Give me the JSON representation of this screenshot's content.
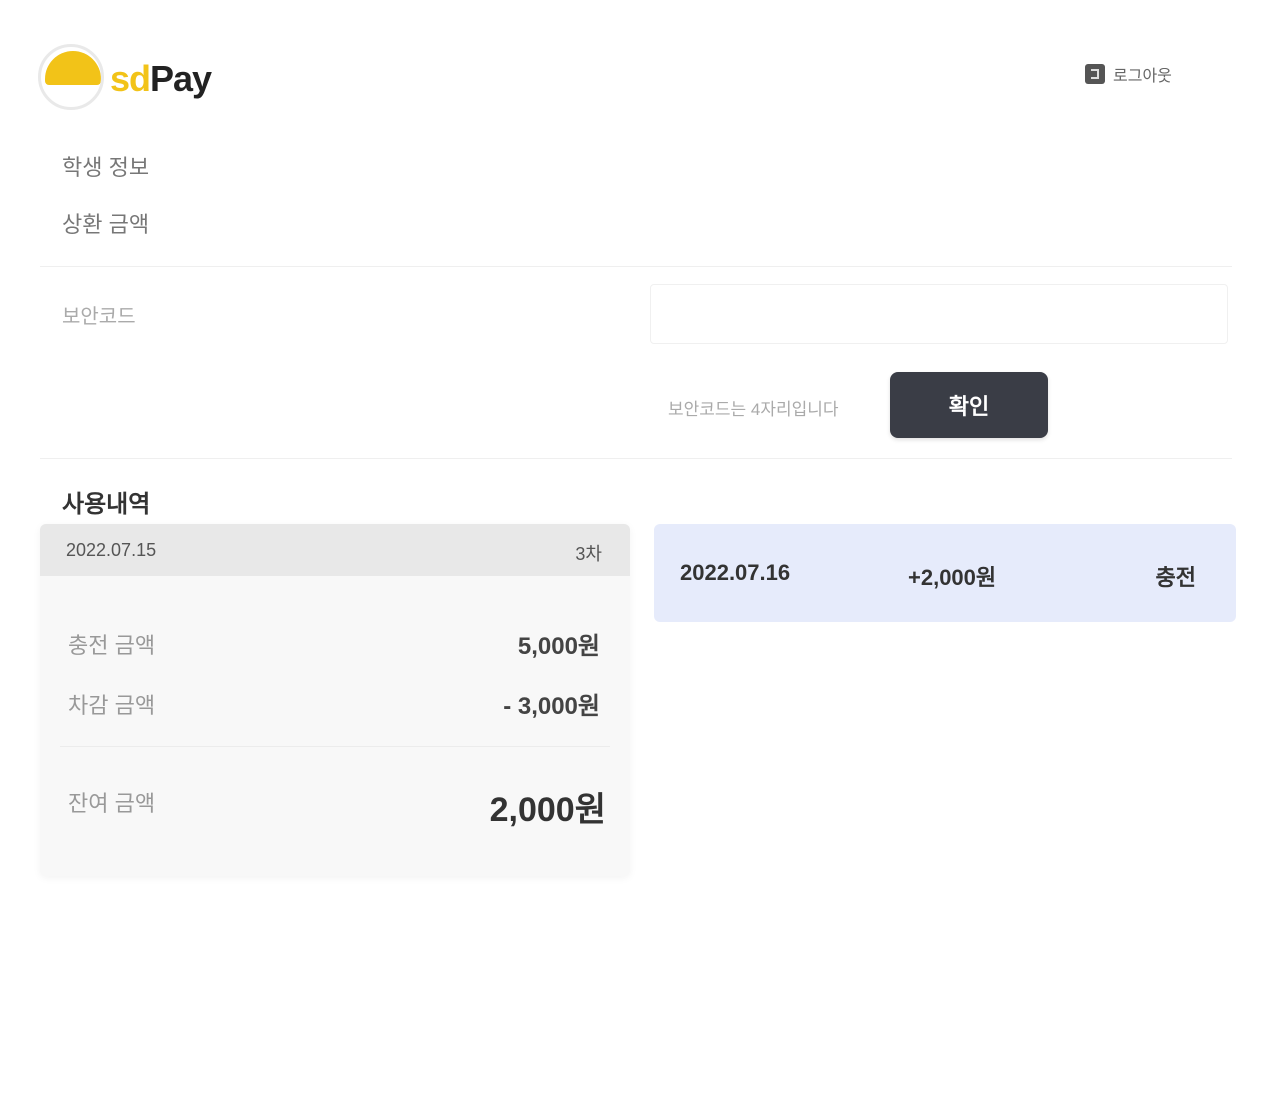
{
  "header": {
    "logo_text_a": "sd",
    "logo_text_b": "Pay",
    "logout_label": "로그아웃"
  },
  "menu": {
    "items": [
      "학생 정보",
      "상환 금액"
    ]
  },
  "code_entry": {
    "label": "보안코드",
    "input_value": "",
    "input_placeholder": "",
    "helper_text": "보안코드는 4자리입니다",
    "confirm_label": "확인"
  },
  "section": {
    "title": "사용내역"
  },
  "summary": {
    "date": "2022.07.15",
    "period": "3차",
    "rows": [
      {
        "label": "충전 금액",
        "value": "5,000원"
      },
      {
        "label": "차감 금액",
        "value": "- 3,000원"
      }
    ],
    "total_label": "잔여 금액",
    "total_value": "2,000원"
  },
  "history": {
    "items": [
      {
        "date": "2022.07.16",
        "amount": "+2,000원",
        "status": "충전"
      }
    ]
  },
  "colors": {
    "brand_yellow": "#f2c318",
    "button_dark": "#3a3d46",
    "history_bg": "#e6ebfb"
  }
}
